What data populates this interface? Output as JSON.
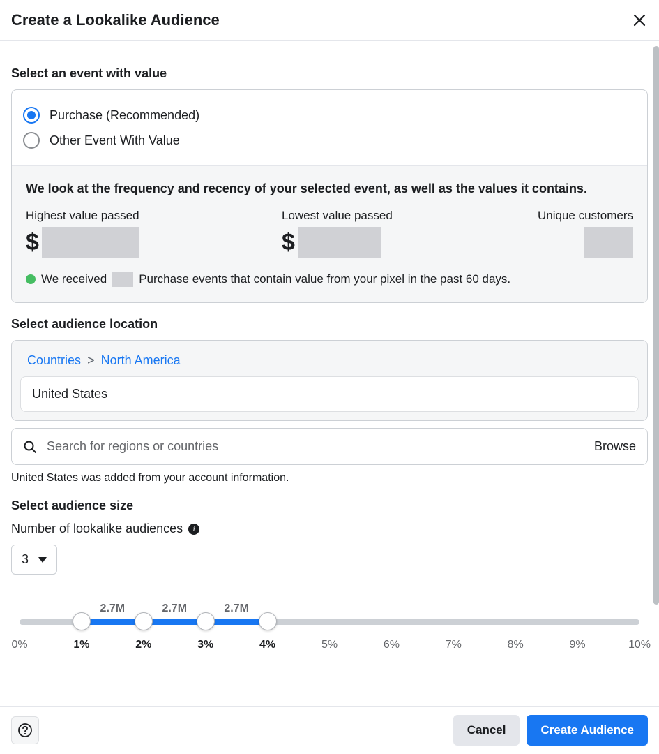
{
  "header": {
    "title": "Create a Lookalike Audience"
  },
  "event_section": {
    "heading": "Select an event with value",
    "options": [
      {
        "label": "Purchase (Recommended)",
        "selected": true
      },
      {
        "label": "Other Event With Value",
        "selected": false
      }
    ],
    "stats_lead": "We look at the frequency and recency of your selected event, as well as the values it contains.",
    "highest_label": "Highest value passed",
    "lowest_label": "Lowest value passed",
    "unique_label": "Unique customers",
    "currency_symbol": "$",
    "events_prefix": "We received",
    "events_suffix": "Purchase events that contain value from your pixel in the past 60 days."
  },
  "location_section": {
    "heading": "Select audience location",
    "breadcrumb": {
      "level1": "Countries",
      "level2": "North America"
    },
    "selected_country": "United States",
    "search_placeholder": "Search for regions or countries",
    "browse_label": "Browse",
    "note": "United States was added from your account information."
  },
  "size_section": {
    "heading": "Select audience size",
    "num_label": "Number of lookalike audiences",
    "num_value": "3",
    "segment_sizes": [
      "2.7M",
      "2.7M",
      "2.7M"
    ],
    "handle_positions_pct": [
      10,
      20,
      30,
      40
    ],
    "ticks": [
      {
        "label": "0%",
        "pos": 0,
        "bold": false
      },
      {
        "label": "1%",
        "pos": 10,
        "bold": true
      },
      {
        "label": "2%",
        "pos": 20,
        "bold": true
      },
      {
        "label": "3%",
        "pos": 30,
        "bold": true
      },
      {
        "label": "4%",
        "pos": 40,
        "bold": true
      },
      {
        "label": "5%",
        "pos": 50,
        "bold": false
      },
      {
        "label": "6%",
        "pos": 60,
        "bold": false
      },
      {
        "label": "7%",
        "pos": 70,
        "bold": false
      },
      {
        "label": "8%",
        "pos": 80,
        "bold": false
      },
      {
        "label": "9%",
        "pos": 90,
        "bold": false
      },
      {
        "label": "10%",
        "pos": 100,
        "bold": false
      }
    ]
  },
  "footer": {
    "cancel": "Cancel",
    "create": "Create Audience"
  }
}
